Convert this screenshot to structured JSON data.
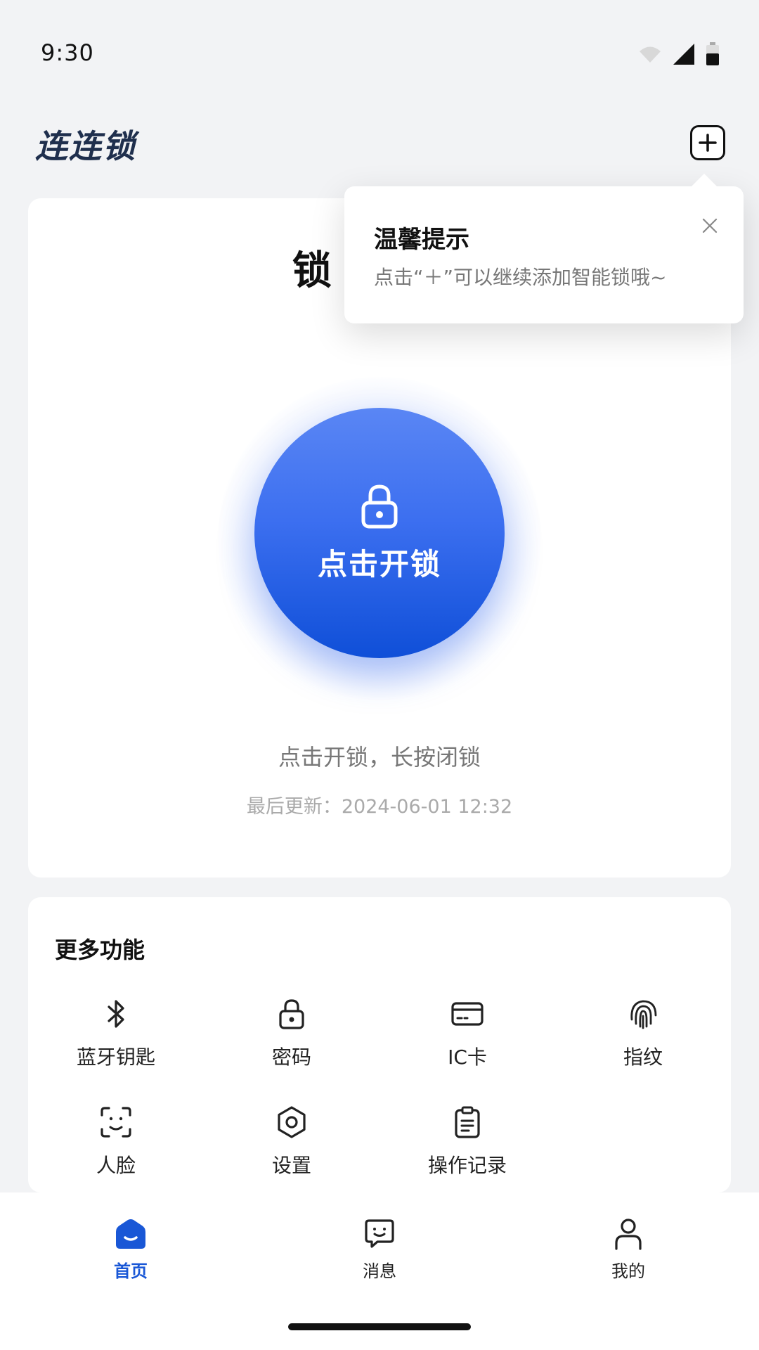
{
  "status_bar": {
    "time": "9:30"
  },
  "header": {
    "title": "连连锁"
  },
  "lock": {
    "name": "锁",
    "unlock_label": "点击开锁",
    "hint": "点击开锁，长按闭锁",
    "last_update_label": "最后更新：",
    "last_update_time": "2024-06-01 12:32"
  },
  "tooltip": {
    "title": "温馨提示",
    "text": "点击“＋”可以继续添加智能锁哦~"
  },
  "more": {
    "title": "更多功能",
    "items": [
      {
        "label": "蓝牙钥匙",
        "icon": "bluetooth-icon"
      },
      {
        "label": "密码",
        "icon": "lock-icon"
      },
      {
        "label": "IC卡",
        "icon": "card-icon"
      },
      {
        "label": "指纹",
        "icon": "fingerprint-icon"
      },
      {
        "label": "人脸",
        "icon": "face-scan-icon"
      },
      {
        "label": "设置",
        "icon": "settings-icon"
      },
      {
        "label": "操作记录",
        "icon": "clipboard-icon"
      }
    ]
  },
  "nav": {
    "items": [
      {
        "label": "首页",
        "icon": "home-icon",
        "active": true
      },
      {
        "label": "消息",
        "icon": "message-icon",
        "active": false
      },
      {
        "label": "我的",
        "icon": "user-icon",
        "active": false
      }
    ]
  },
  "colors": {
    "accent": "#1957d6",
    "button_top": "#5a86f4",
    "button_bottom": "#0f4fd8",
    "title": "#1f2f4d"
  }
}
